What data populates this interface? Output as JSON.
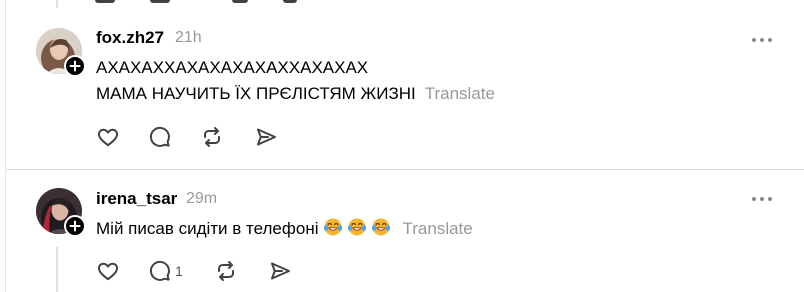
{
  "posts": [
    {
      "username": "fox.zh27",
      "time": "21h",
      "lines": [
        "АХАХАХХАХАХАХАХАХХАХАХАХ",
        "МАМА НАУЧИТЬ ЇХ ПРЄЛІСТЯМ ЖИЗНІ"
      ],
      "translate": "Translate",
      "reply_count": ""
    },
    {
      "username": "irena_tsar",
      "time": "29m",
      "lines": [
        "Мій писав сидіти в телефоні"
      ],
      "emoji": "face-with-tears-of-joy",
      "translate": "Translate",
      "reply_count": "1"
    }
  ],
  "icons": {
    "like": "heart-icon",
    "reply": "comment-icon",
    "repost": "repost-icon",
    "share": "send-icon",
    "more": "more-dots-icon",
    "follow": "plus-icon"
  },
  "colors": {
    "text": "#000000",
    "muted": "#999999",
    "icon": "#424242",
    "divider": "#dedede"
  }
}
